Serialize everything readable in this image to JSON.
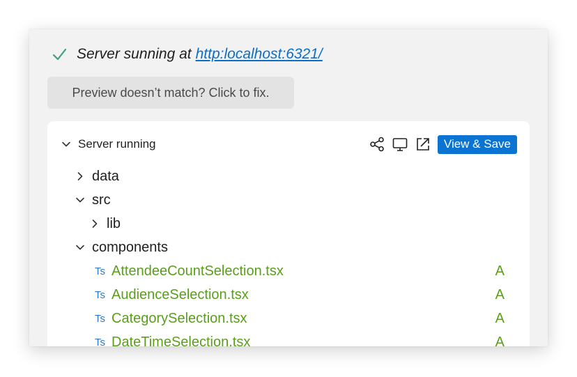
{
  "status": {
    "text": "Server sunning at",
    "link": "http:localhost:6321/"
  },
  "fix_button": {
    "label": "Preview doesn’t match? Click to fix."
  },
  "card": {
    "header": {
      "title": "Server running",
      "view_save_label": "View & Save"
    },
    "tree": {
      "folders": [
        {
          "label": "data",
          "expanded": false
        },
        {
          "label": "src",
          "expanded": true
        },
        {
          "label": "lib",
          "expanded": false
        },
        {
          "label": "components",
          "expanded": true
        }
      ],
      "file_badge": "Ts",
      "files": [
        {
          "name": "AttendeeCountSelection.tsx",
          "status": "A"
        },
        {
          "name": "AudienceSelection.tsx",
          "status": "A"
        },
        {
          "name": "CategorySelection.tsx",
          "status": "A"
        },
        {
          "name": "DateTimeSelection.tsx",
          "status": "A"
        }
      ]
    }
  },
  "icons": [
    "check-icon",
    "chevron-down-icon",
    "chevron-right-icon",
    "share-icon",
    "monitor-icon",
    "open-external-icon"
  ],
  "colors": {
    "accent": "#0b73d1",
    "link": "#0b6fc9",
    "added": "#5a9e1c",
    "check": "#3aa37a",
    "ts": "#2d79c7"
  }
}
